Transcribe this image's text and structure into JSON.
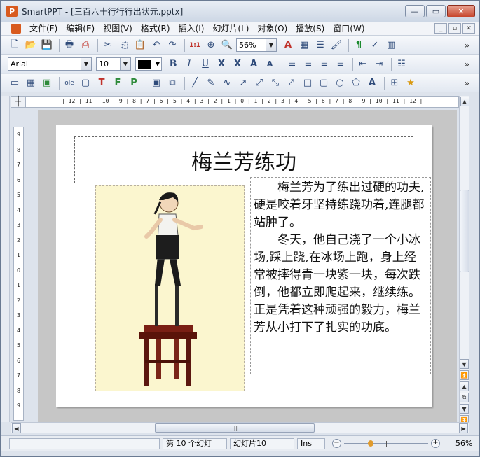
{
  "window": {
    "app_name": "SmartPPT",
    "title": "SmartPPT - [三百六十行行行出状元.pptx]",
    "controls": {
      "minimize": "—",
      "maximize": "▭",
      "close": "✕"
    }
  },
  "menubar": {
    "items": [
      "文件(F)",
      "编辑(E)",
      "视图(V)",
      "格式(R)",
      "插入(I)",
      "幻灯片(L)",
      "对象(O)",
      "播放(S)",
      "窗口(W)"
    ],
    "mdi_controls": [
      "_",
      "▫",
      "✕"
    ]
  },
  "toolbar_standard": {
    "zoom_value": "56%",
    "more": "»"
  },
  "toolbar_format": {
    "font_name": "Arial",
    "font_size": "10",
    "font_color": "#000000",
    "bold": "B",
    "italic": "I",
    "underline": "U",
    "strike": "X",
    "clear": "X",
    "grow": "A",
    "shrink": "A",
    "more": "»"
  },
  "toolbar_draw": {
    "more": "»"
  },
  "ruler": {
    "horizontal": "| 12 | 11 | 10 | 9 | 8 | 7 | 6 | 5 | 4 | 3 | 2 | 1 | 0 | 1 | 2 | 3 | 4 | 5 | 6 | 7 | 8 | 9 | 10 | 11 | 12 |",
    "vertical": [
      "9",
      "8",
      "7",
      "6",
      "5",
      "4",
      "3",
      "2",
      "1",
      "0",
      "1",
      "2",
      "3",
      "4",
      "5",
      "6",
      "7",
      "8",
      "9"
    ]
  },
  "slide": {
    "title": "梅兰芳练功",
    "paragraphs": [
      "梅兰芳为了练出过硬的功夫,硬是咬着牙坚持练跷功着,连腿都站肿了。",
      "冬天，他自己浇了一个小冰场,踩上跷,在冰场上跑，身上经常被摔得青一块紫一块，每次跌倒，他都立即爬起来，继续练。正是凭着这种顽强的毅力，梅兰芳从小打下了扎实的功底。"
    ]
  },
  "statusbar": {
    "slide_pos": "第 10 个幻灯",
    "slide_name": "幻灯片10",
    "mode": "Ins",
    "zoom": "56%",
    "zoom_fraction": 0.56
  }
}
